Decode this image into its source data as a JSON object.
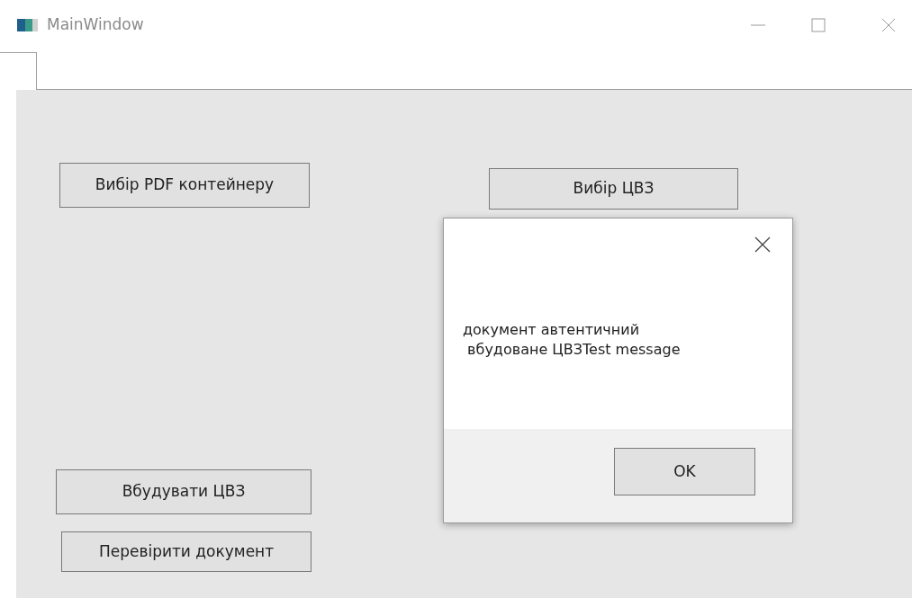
{
  "window": {
    "title": "MainWindow"
  },
  "buttons": [
    {
      "label": "Вибір PDF контейнеру"
    },
    {
      "label": "Вибір ЦВЗ"
    },
    {
      "label": "Вбудувати ЦВЗ"
    },
    {
      "label": "Перевірити документ"
    }
  ],
  "dialog": {
    "message": "документ автентичний\n вбудоване ЦВЗTest message",
    "buttons": [
      "OK"
    ]
  }
}
